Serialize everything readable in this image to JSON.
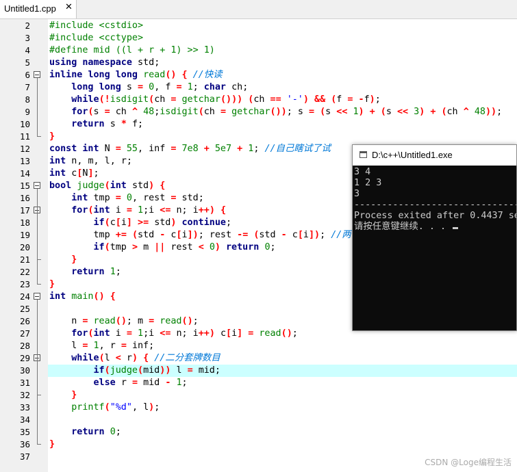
{
  "tab": {
    "label": "Untitled1.cpp",
    "close": "✕"
  },
  "editor": {
    "highlighted_line": "30",
    "lines": [
      {
        "n": "2",
        "text": "#include <cstdio>"
      },
      {
        "n": "3",
        "text": "#include <cctype>"
      },
      {
        "n": "4",
        "text": "#define mid ((l + r + 1) >> 1)"
      },
      {
        "n": "5",
        "text": "using namespace std;"
      },
      {
        "n": "6",
        "text": "inline long long read() { //快读"
      },
      {
        "n": "7",
        "text": "    long long s = 0, f = 1; char ch;"
      },
      {
        "n": "8",
        "text": "    while(!isdigit(ch = getchar())) (ch == '-') && (f = -f);"
      },
      {
        "n": "9",
        "text": "    for(s = ch ^ 48;isdigit(ch = getchar()); s = (s << 1) + (s << 3) + (ch ^ 48));"
      },
      {
        "n": "10",
        "text": "    return s * f;"
      },
      {
        "n": "11",
        "text": "}"
      },
      {
        "n": "12",
        "text": "const int N = 55, inf = 7e8 + 5e7 + 1; //自己瞎试了试"
      },
      {
        "n": "13",
        "text": "int n, m, l, r;"
      },
      {
        "n": "14",
        "text": "int c[N];"
      },
      {
        "n": "15",
        "text": "bool judge(int std) {"
      },
      {
        "n": "16",
        "text": "    int tmp = 0, rest = std;"
      },
      {
        "n": "17",
        "text": "    for(int i = 1;i <= n; i++) {"
      },
      {
        "n": "18",
        "text": "        if(c[i] >= std) continue;"
      },
      {
        "n": "19",
        "text": "        tmp += (std - c[i]); rest -= (std - c[i]); //两"
      },
      {
        "n": "20",
        "text": "        if(tmp > m || rest < 0) return 0;"
      },
      {
        "n": "21",
        "text": "    }"
      },
      {
        "n": "22",
        "text": "    return 1;"
      },
      {
        "n": "23",
        "text": "}"
      },
      {
        "n": "24",
        "text": "int main() {"
      },
      {
        "n": "25",
        "text": ""
      },
      {
        "n": "26",
        "text": "    n = read(); m = read();"
      },
      {
        "n": "27",
        "text": "    for(int i = 1;i <= n; i++) c[i] = read();"
      },
      {
        "n": "28",
        "text": "    l = 1, r = inf;"
      },
      {
        "n": "29",
        "text": "    while(l < r) { //二分套牌数目"
      },
      {
        "n": "30",
        "text": "        if(judge(mid)) l = mid;"
      },
      {
        "n": "31",
        "text": "        else r = mid - 1;"
      },
      {
        "n": "32",
        "text": "    }"
      },
      {
        "n": "33",
        "text": "    printf(\"%d\", l);"
      },
      {
        "n": "34",
        "text": ""
      },
      {
        "n": "35",
        "text": "    return 0;"
      },
      {
        "n": "36",
        "text": "}"
      },
      {
        "n": "37",
        "text": ""
      }
    ]
  },
  "console": {
    "title": "D:\\c++\\Untitled1.exe",
    "lines": [
      "3 4",
      "1 2 3",
      "3",
      "--------------------------------",
      "Process exited after 0.4437 se",
      "请按任意键继续. . . "
    ]
  },
  "watermark": "CSDN @Loge编程生活"
}
